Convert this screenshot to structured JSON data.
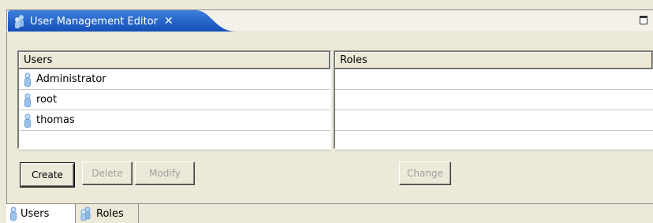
{
  "editor": {
    "tab_title": "User Management Editor",
    "close_glyph": "✕",
    "tab_icon": "users-group-icon",
    "maximize_icon": "maximize-icon"
  },
  "users_table": {
    "header": "Users",
    "rows": [
      "Administrator",
      "root",
      "thomas"
    ],
    "row_icon": "user-icon"
  },
  "roles_table": {
    "header": "Roles",
    "rows": []
  },
  "buttons": {
    "create": "Create",
    "delete": "Delete",
    "modify": "Modify",
    "change": "Change"
  },
  "bottom_tabs": [
    {
      "label": "Users",
      "icon": "user-icon",
      "selected": true
    },
    {
      "label": "Roles",
      "icon": "users-group-icon",
      "selected": false
    }
  ],
  "colors": {
    "tab_active": "#1f64c8",
    "background": "#ece9d8",
    "icon_blue": "#6fa3dc"
  }
}
